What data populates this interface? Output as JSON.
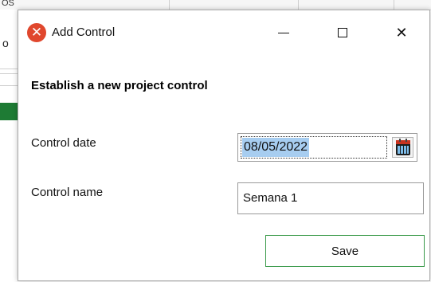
{
  "background": {
    "topstrip_fragment": "OS",
    "left_fragment": "o"
  },
  "window": {
    "title": "Add Control",
    "icon_glyph": "✕",
    "icon_name": "app-x-icon",
    "controls": {
      "minimize": "minimize-icon",
      "maximize": "maximize-icon",
      "close": "close-icon",
      "close_glyph": "✕"
    }
  },
  "form": {
    "heading": "Establish a new project control",
    "date_label": "Control date",
    "date_value": "08/05/2022",
    "calendar_icon": "calendar-icon",
    "name_label": "Control name",
    "name_value": "Semana 1",
    "save_label": "Save"
  },
  "colors": {
    "accent_green": "#3a9a4a",
    "selection_blue": "#a7cdf0",
    "app_icon_red": "#e0472d"
  }
}
